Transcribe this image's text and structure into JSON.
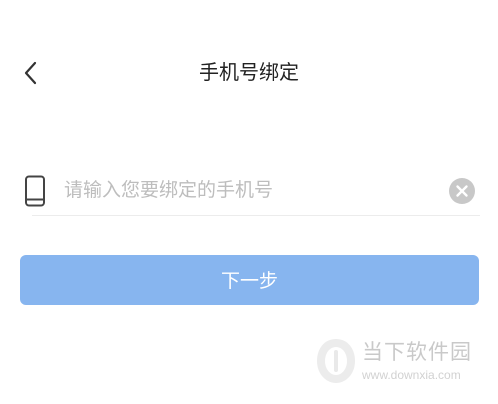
{
  "header": {
    "title": "手机号绑定",
    "back_icon": "chevron-left-icon"
  },
  "form": {
    "phone_icon": "mobile-phone-icon",
    "phone_value": "",
    "phone_placeholder": "请输入您要绑定的手机号",
    "clear_icon": "clear-x-icon"
  },
  "actions": {
    "next_label": "下一步"
  },
  "watermark": {
    "title": "当下软件园",
    "url": "www.downxia.com"
  },
  "colors": {
    "primary_button": "#87b5ef",
    "divider": "#ececec",
    "placeholder": "#bdbdbd",
    "clear_icon": "#c8c8c8"
  }
}
